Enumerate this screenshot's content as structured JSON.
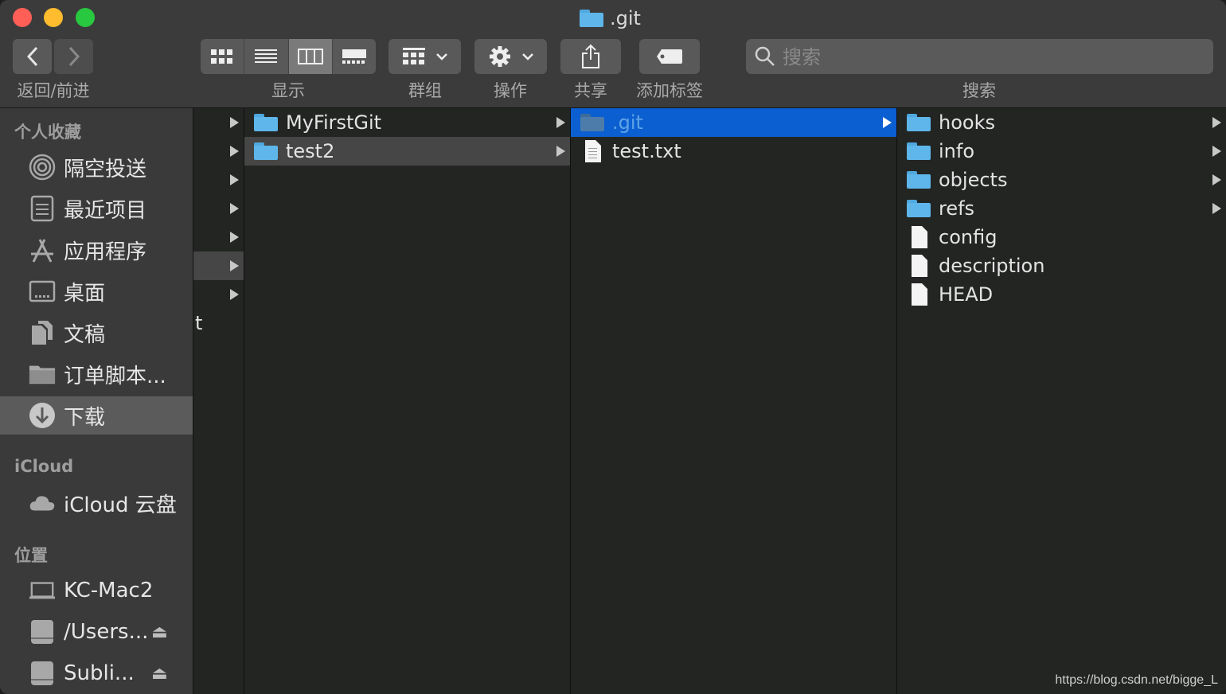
{
  "window": {
    "title": ".git"
  },
  "toolbar": {
    "nav_label": "返回/前进",
    "view_label": "显示",
    "group_label": "群组",
    "action_label": "操作",
    "share_label": "共享",
    "tag_label": "添加标签",
    "search_label": "搜索",
    "search_placeholder": "搜索"
  },
  "sidebar": {
    "favorites_header": "个人收藏",
    "favorites": [
      {
        "label": "隔空投送",
        "icon": "airdrop-icon"
      },
      {
        "label": "最近项目",
        "icon": "recents-icon"
      },
      {
        "label": "应用程序",
        "icon": "applications-icon"
      },
      {
        "label": "桌面",
        "icon": "desktop-icon"
      },
      {
        "label": "文稿",
        "icon": "documents-icon"
      },
      {
        "label": "订单脚本...",
        "icon": "folder-icon"
      },
      {
        "label": "下载",
        "icon": "downloads-icon"
      }
    ],
    "icloud_header": "iCloud",
    "icloud": [
      {
        "label": "iCloud 云盘",
        "icon": "cloud-icon"
      }
    ],
    "locations_header": "位置",
    "locations": [
      {
        "label": "KC-Mac2",
        "icon": "computer-icon"
      },
      {
        "label": "/Users...",
        "icon": "disk-icon"
      },
      {
        "label": "Subli...",
        "icon": "disk-icon"
      }
    ]
  },
  "columns": {
    "col0_partial_text": "t",
    "col1": [
      {
        "name": "MyFirstGit"
      },
      {
        "name": "test2"
      }
    ],
    "col2": [
      {
        "name": ".git"
      },
      {
        "name": "test.txt"
      }
    ],
    "col3": [
      {
        "name": "hooks"
      },
      {
        "name": "info"
      },
      {
        "name": "objects"
      },
      {
        "name": "refs"
      },
      {
        "name": "config"
      },
      {
        "name": "description"
      },
      {
        "name": "HEAD"
      }
    ]
  },
  "colors": {
    "selection_blue": "#0b5fd0",
    "folder_blue": "#5eb6ea"
  },
  "watermark": "https://blog.csdn.net/bigge_L"
}
